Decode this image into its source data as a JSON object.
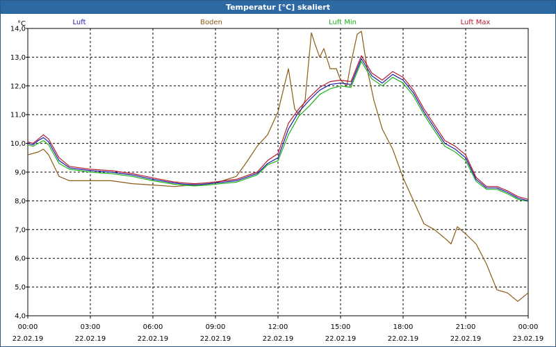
{
  "window": {
    "title": "Temperatur [°C] skaliert"
  },
  "chart_data": {
    "type": "line",
    "title": "Temperatur [°C] skaliert",
    "ylabel": "°C",
    "ylim": [
      4.0,
      14.0
    ],
    "y_ticks": [
      "14,0",
      "13,0",
      "12,0",
      "11,0",
      "10,0",
      "9,0",
      "8,0",
      "7,0",
      "6,0",
      "5,0",
      "4,0"
    ],
    "x_ticks": [
      {
        "time": "00:00",
        "date": "22.02.19"
      },
      {
        "time": "03:00",
        "date": "22.02.19"
      },
      {
        "time": "06:00",
        "date": "22.02.19"
      },
      {
        "time": "09:00",
        "date": "22.02.19"
      },
      {
        "time": "12:00",
        "date": "22.02.19"
      },
      {
        "time": "15:00",
        "date": "22.02.19"
      },
      {
        "time": "18:00",
        "date": "22.02.19"
      },
      {
        "time": "21:00",
        "date": "22.02.19"
      },
      {
        "time": "00:00",
        "date": "23.02.19"
      }
    ],
    "grid": true,
    "legend_position": "top",
    "series": [
      {
        "name": "Luft",
        "color": "#1a1aa6",
        "x": [
          0,
          0.25,
          0.5,
          0.75,
          1,
          1.5,
          2,
          2.5,
          3,
          4,
          5,
          6,
          7,
          7.5,
          8,
          8.5,
          9,
          10,
          11,
          11.5,
          12,
          12.5,
          13,
          13.5,
          14,
          14.5,
          15,
          15.5,
          16,
          16.5,
          17,
          17.5,
          18,
          18.5,
          19,
          19.5,
          20,
          20.5,
          21,
          21.5,
          22,
          22.5,
          23,
          23.5,
          24
        ],
        "y": [
          10.0,
          9.95,
          10.1,
          10.2,
          10.05,
          9.4,
          9.15,
          9.1,
          9.05,
          9.0,
          8.9,
          8.75,
          8.62,
          8.58,
          8.56,
          8.58,
          8.62,
          8.7,
          8.95,
          9.3,
          9.5,
          10.5,
          11.1,
          11.5,
          11.85,
          12.05,
          12.1,
          12.05,
          12.95,
          12.35,
          12.1,
          12.4,
          12.2,
          11.75,
          11.1,
          10.55,
          10.0,
          9.8,
          9.5,
          8.75,
          8.45,
          8.45,
          8.3,
          8.1,
          8.0
        ]
      },
      {
        "name": "Boden",
        "color": "#8b5a14",
        "x": [
          0,
          0.5,
          0.75,
          1,
          1.5,
          2,
          3,
          4,
          5,
          6,
          7,
          8,
          9,
          10,
          10.5,
          11,
          11.5,
          12,
          12.5,
          12.8,
          13,
          13.3,
          13.6,
          13.8,
          14,
          14.2,
          14.5,
          14.8,
          15,
          15.3,
          15.5,
          15.8,
          16,
          16.3,
          16.6,
          17,
          17.5,
          18,
          18.5,
          19,
          19.5,
          20,
          20.3,
          20.6,
          21,
          21.5,
          22,
          22.5,
          23,
          23.5,
          24
        ],
        "y": [
          9.6,
          9.7,
          9.8,
          9.6,
          8.85,
          8.7,
          8.7,
          8.7,
          8.6,
          8.55,
          8.5,
          8.55,
          8.62,
          8.85,
          9.35,
          9.9,
          10.3,
          11.1,
          12.6,
          11.2,
          11.0,
          11.5,
          13.85,
          13.4,
          13.0,
          13.3,
          12.6,
          12.6,
          12.2,
          12.0,
          12.8,
          13.8,
          13.9,
          12.5,
          11.5,
          10.5,
          9.8,
          8.8,
          8.0,
          7.2,
          7.0,
          6.7,
          6.5,
          7.1,
          6.85,
          6.5,
          5.8,
          4.9,
          4.8,
          4.5,
          4.8
        ]
      },
      {
        "name": "Luft Min",
        "color": "#19b319",
        "x": [
          0,
          0.25,
          0.5,
          0.75,
          1,
          1.5,
          2,
          2.5,
          3,
          4,
          5,
          6,
          7,
          7.5,
          8,
          8.5,
          9,
          10,
          11,
          11.5,
          12,
          12.5,
          13,
          13.5,
          14,
          14.5,
          15,
          15.5,
          16,
          16.5,
          17,
          17.5,
          18,
          18.5,
          19,
          19.5,
          20,
          20.5,
          21,
          21.5,
          22,
          22.5,
          23,
          23.5,
          24
        ],
        "y": [
          9.95,
          9.9,
          10.0,
          10.1,
          9.95,
          9.3,
          9.1,
          9.05,
          9.0,
          8.95,
          8.85,
          8.7,
          8.58,
          8.54,
          8.52,
          8.54,
          8.58,
          8.65,
          8.9,
          9.25,
          9.4,
          10.3,
          10.95,
          11.3,
          11.7,
          11.9,
          12.0,
          11.95,
          12.85,
          12.25,
          12.0,
          12.3,
          12.1,
          11.65,
          11.0,
          10.45,
          9.9,
          9.7,
          9.4,
          8.68,
          8.4,
          8.4,
          8.25,
          8.05,
          7.98
        ]
      },
      {
        "name": "Luft Max",
        "color": "#b3192d",
        "x": [
          0,
          0.25,
          0.5,
          0.75,
          1,
          1.5,
          2,
          2.5,
          3,
          4,
          5,
          6,
          7,
          7.5,
          8,
          8.5,
          9,
          10,
          11,
          11.5,
          12,
          12.5,
          13,
          13.5,
          14,
          14.5,
          15,
          15.5,
          16,
          16.5,
          17,
          17.5,
          18,
          18.5,
          19,
          19.5,
          20,
          20.5,
          21,
          21.5,
          22,
          22.5,
          23,
          23.5,
          24
        ],
        "y": [
          10.05,
          10.0,
          10.15,
          10.3,
          10.15,
          9.5,
          9.2,
          9.15,
          9.1,
          9.05,
          8.95,
          8.8,
          8.66,
          8.62,
          8.6,
          8.62,
          8.66,
          8.75,
          9.0,
          9.4,
          9.65,
          10.7,
          11.2,
          11.6,
          11.95,
          12.15,
          12.2,
          12.15,
          13.05,
          12.45,
          12.2,
          12.5,
          12.3,
          11.85,
          11.2,
          10.65,
          10.1,
          9.9,
          9.6,
          8.82,
          8.5,
          8.5,
          8.35,
          8.15,
          8.05
        ]
      }
    ]
  }
}
